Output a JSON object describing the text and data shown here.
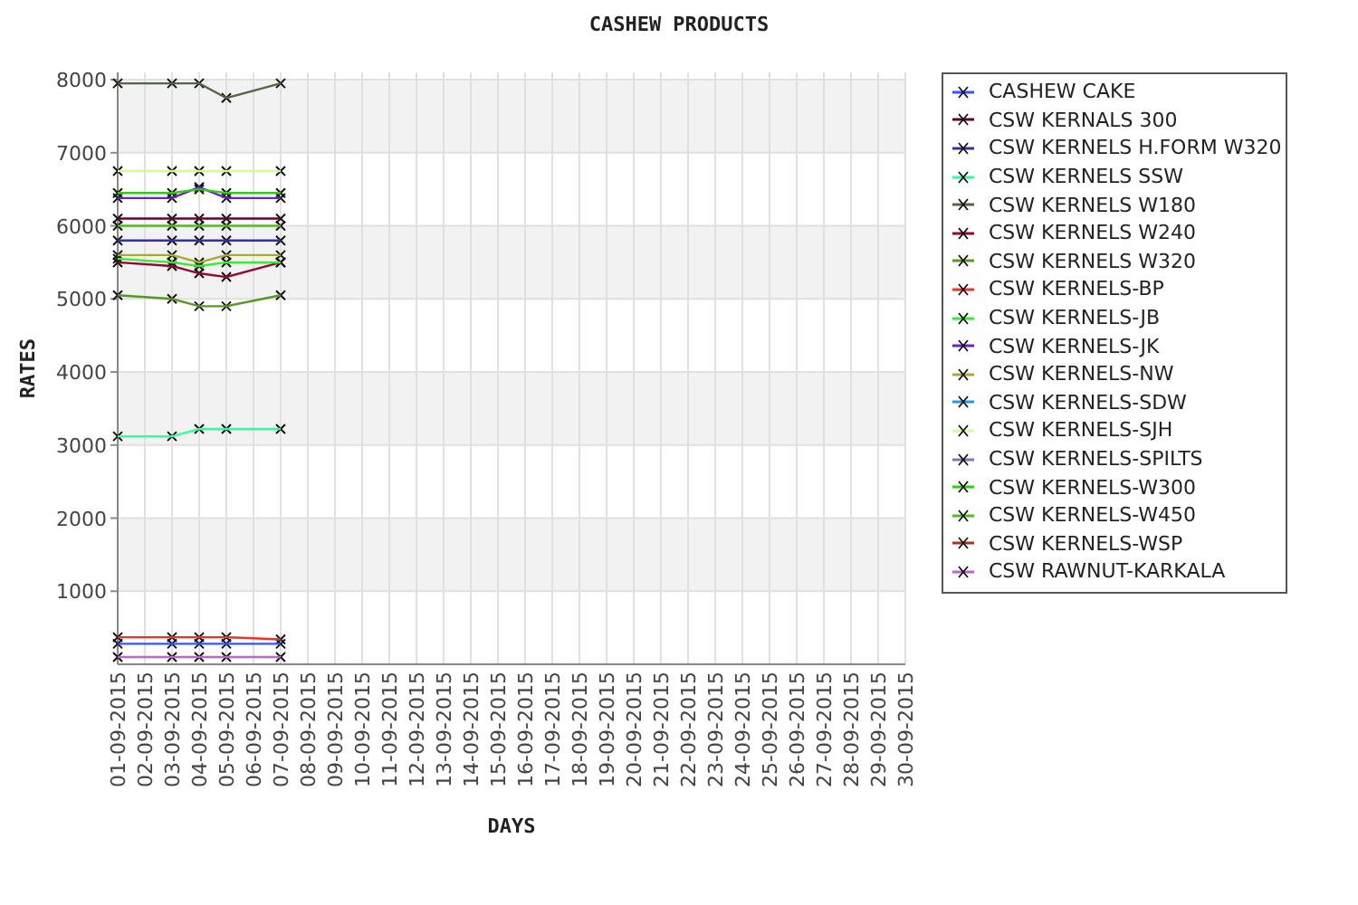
{
  "chart": {
    "chart_data": {
      "type": "line",
      "title": "CASHEW PRODUCTS",
      "xlabel": "DAYS",
      "ylabel": "RATES",
      "grid": true,
      "categories": [
        "01-09-2015",
        "02-09-2015",
        "03-09-2015",
        "04-09-2015",
        "05-09-2015",
        "06-09-2015",
        "07-09-2015",
        "08-09-2015",
        "09-09-2015",
        "10-09-2015",
        "11-09-2015",
        "12-09-2015",
        "13-09-2015",
        "14-09-2015",
        "15-09-2015",
        "16-09-2015",
        "17-09-2015",
        "18-09-2015",
        "19-09-2015",
        "20-09-2015",
        "21-09-2015",
        "22-09-2015",
        "23-09-2015",
        "24-09-2015",
        "25-09-2015",
        "26-09-2015",
        "27-09-2015",
        "28-09-2015",
        "29-09-2015",
        "30-09-2015"
      ],
      "ylim": [
        0,
        8100
      ],
      "yticks": [
        1000,
        2000,
        3000,
        4000,
        5000,
        6000,
        7000,
        8000
      ],
      "series": [
        {
          "name": "CASHEW CAKE",
          "color": "#3355ff",
          "marker": "x",
          "values": [
            280,
            null,
            280,
            280,
            280,
            null,
            280,
            null,
            null,
            null,
            null,
            null,
            null,
            null,
            null,
            null,
            null,
            null,
            null,
            null,
            null,
            null,
            null,
            null,
            null,
            null,
            null,
            null,
            null,
            null
          ]
        },
        {
          "name": "CSW KERNALS 300",
          "color": "#660033",
          "marker": "x",
          "values": [
            6100,
            null,
            6100,
            6100,
            6100,
            null,
            6100,
            null,
            null,
            null,
            null,
            null,
            null,
            null,
            null,
            null,
            null,
            null,
            null,
            null,
            null,
            null,
            null,
            null,
            null,
            null,
            null,
            null,
            null,
            null
          ]
        },
        {
          "name": "CSW KERNELS H.FORM W320",
          "color": "#333399",
          "marker": "x",
          "values": [
            5800,
            null,
            5800,
            5800,
            5800,
            null,
            5800,
            null,
            null,
            null,
            null,
            null,
            null,
            null,
            null,
            null,
            null,
            null,
            null,
            null,
            null,
            null,
            null,
            null,
            null,
            null,
            null,
            null,
            null,
            null
          ]
        },
        {
          "name": "CSW KERNELS SSW",
          "color": "#33ff99",
          "marker": "x",
          "values": [
            3120,
            null,
            3120,
            3220,
            3220,
            null,
            3220,
            null,
            null,
            null,
            null,
            null,
            null,
            null,
            null,
            null,
            null,
            null,
            null,
            null,
            null,
            null,
            null,
            null,
            null,
            null,
            null,
            null,
            null,
            null
          ]
        },
        {
          "name": "CSW KERNELS W180",
          "color": "#556644",
          "marker": "x",
          "values": [
            7950,
            null,
            7950,
            7950,
            7750,
            null,
            7950,
            null,
            null,
            null,
            null,
            null,
            null,
            null,
            null,
            null,
            null,
            null,
            null,
            null,
            null,
            null,
            null,
            null,
            null,
            null,
            null,
            null,
            null,
            null
          ]
        },
        {
          "name": "CSW KERNELS W240",
          "color": "#990033",
          "marker": "x",
          "values": [
            5500,
            null,
            5450,
            5350,
            5300,
            null,
            5500,
            null,
            null,
            null,
            null,
            null,
            null,
            null,
            null,
            null,
            null,
            null,
            null,
            null,
            null,
            null,
            null,
            null,
            null,
            null,
            null,
            null,
            null,
            null
          ]
        },
        {
          "name": "CSW KERNELS W320",
          "color": "#559922",
          "marker": "x",
          "values": [
            5050,
            null,
            5000,
            4900,
            4900,
            null,
            5050,
            null,
            null,
            null,
            null,
            null,
            null,
            null,
            null,
            null,
            null,
            null,
            null,
            null,
            null,
            null,
            null,
            null,
            null,
            null,
            null,
            null,
            null,
            null
          ]
        },
        {
          "name": "CSW KERNELS-BP",
          "color": "#ee3322",
          "marker": "x",
          "values": [
            370,
            null,
            370,
            370,
            370,
            null,
            340,
            null,
            null,
            null,
            null,
            null,
            null,
            null,
            null,
            null,
            null,
            null,
            null,
            null,
            null,
            null,
            null,
            null,
            null,
            null,
            null,
            null,
            null,
            null
          ]
        },
        {
          "name": "CSW KERNELS-JB",
          "color": "#33ee33",
          "marker": "x",
          "values": [
            5550,
            null,
            5500,
            5450,
            5500,
            null,
            5500,
            null,
            null,
            null,
            null,
            null,
            null,
            null,
            null,
            null,
            null,
            null,
            null,
            null,
            null,
            null,
            null,
            null,
            null,
            null,
            null,
            null,
            null,
            null
          ]
        },
        {
          "name": "CSW KERNELS-JK",
          "color": "#6622cc",
          "marker": "x",
          "values": [
            6380,
            null,
            6380,
            6530,
            6380,
            null,
            6380,
            null,
            null,
            null,
            null,
            null,
            null,
            null,
            null,
            null,
            null,
            null,
            null,
            null,
            null,
            null,
            null,
            null,
            null,
            null,
            null,
            null,
            null,
            null
          ]
        },
        {
          "name": "CSW KERNELS-NW",
          "color": "#aaaa33",
          "marker": "x",
          "values": [
            5600,
            null,
            5600,
            5500,
            5600,
            null,
            5600,
            null,
            null,
            null,
            null,
            null,
            null,
            null,
            null,
            null,
            null,
            null,
            null,
            null,
            null,
            null,
            null,
            null,
            null,
            null,
            null,
            null,
            null,
            null
          ]
        },
        {
          "name": "CSW KERNELS-SDW",
          "color": "#2299ee",
          "marker": "x",
          "values": [
            null,
            null,
            null,
            null,
            null,
            null,
            null,
            null,
            null,
            null,
            null,
            null,
            null,
            null,
            null,
            null,
            null,
            null,
            null,
            null,
            null,
            null,
            null,
            null,
            null,
            null,
            null,
            null,
            null,
            null
          ]
        },
        {
          "name": "CSW KERNELS-SJH",
          "color": "#ccff99",
          "marker": "x",
          "values": [
            6750,
            null,
            6750,
            6750,
            6750,
            null,
            6750,
            null,
            null,
            null,
            null,
            null,
            null,
            null,
            null,
            null,
            null,
            null,
            null,
            null,
            null,
            null,
            null,
            null,
            null,
            null,
            null,
            null,
            null,
            null
          ]
        },
        {
          "name": "CSW KERNELS-SPILTS",
          "color": "#7777cc",
          "marker": "x",
          "values": [
            null,
            null,
            null,
            null,
            null,
            null,
            null,
            null,
            null,
            null,
            null,
            null,
            null,
            null,
            null,
            null,
            null,
            null,
            null,
            null,
            null,
            null,
            null,
            null,
            null,
            null,
            null,
            null,
            null,
            null
          ]
        },
        {
          "name": "CSW KERNELS-W300",
          "color": "#33cc11",
          "marker": "x",
          "values": [
            6450,
            null,
            6450,
            6500,
            6450,
            null,
            6450,
            null,
            null,
            null,
            null,
            null,
            null,
            null,
            null,
            null,
            null,
            null,
            null,
            null,
            null,
            null,
            null,
            null,
            null,
            null,
            null,
            null,
            null,
            null
          ]
        },
        {
          "name": "CSW KERNELS-W450",
          "color": "#55bb22",
          "marker": "x",
          "values": [
            6000,
            null,
            6000,
            6000,
            6000,
            null,
            6000,
            null,
            null,
            null,
            null,
            null,
            null,
            null,
            null,
            null,
            null,
            null,
            null,
            null,
            null,
            null,
            null,
            null,
            null,
            null,
            null,
            null,
            null,
            null
          ]
        },
        {
          "name": "CSW KERNELS-WSP",
          "color": "#aa3322",
          "marker": "x",
          "values": [
            null,
            null,
            null,
            null,
            null,
            null,
            null,
            null,
            null,
            null,
            null,
            null,
            null,
            null,
            null,
            null,
            null,
            null,
            null,
            null,
            null,
            null,
            null,
            null,
            null,
            null,
            null,
            null,
            null,
            null
          ]
        },
        {
          "name": "CSW RAWNUT-KARKALA",
          "color": "#bb66cc",
          "marker": "x",
          "values": [
            100,
            null,
            100,
            100,
            100,
            null,
            100,
            null,
            null,
            null,
            null,
            null,
            null,
            null,
            null,
            null,
            null,
            null,
            null,
            null,
            null,
            null,
            null,
            null,
            null,
            null,
            null,
            null,
            null,
            null
          ]
        }
      ]
    }
  }
}
